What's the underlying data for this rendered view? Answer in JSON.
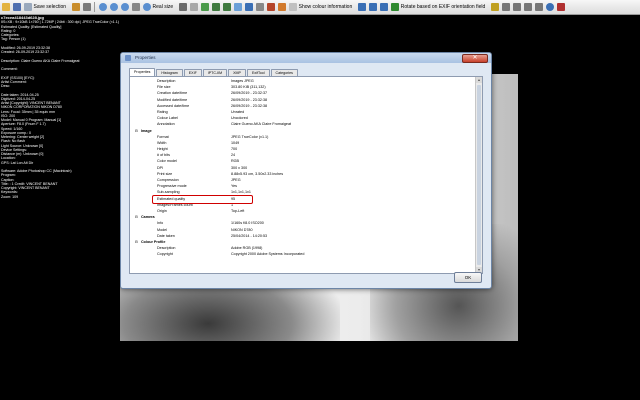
{
  "toolbar": {
    "save_selection": "Save selection",
    "real_size": "Real size",
    "show_colour_information": "Show colour information",
    "rotate_exif": "Rotate based on EXIF orientation field"
  },
  "info_panel": {
    "filename": "c7ecea418443d628.jpg",
    "lines": [
      "IIS=XB : 9×10kB 1×760 | 1.72MP | 24bit : 300 dpi | JPEG TrueColor (×1.1)",
      "Estimated Quality: [Estimated Quality]",
      "Rating: 0",
      "Categories:",
      "Tag: Person (1)",
      "",
      "Modified: 26-09-2019 23:32:38",
      "Created: 26-09-2019 23:32:37",
      "",
      "Description: Claire Gueno AKA Claire Fromaigeat",
      "",
      "Comment:",
      "",
      "EXIF (SS100) [EYC]:",
      "Artist Comment:",
      "Desc:",
      "",
      "Date taken: 2014-04-25",
      "Digitized: 2014-04-25",
      "Artist [Copyright]: VINCENT BENANT",
      "NIKON CORPORATION NIKON D780",
      "Lens: Focal: 35mm | 35 equiv mm",
      "ISO: 200",
      "Model: Manual 0 Program: Manual [1]",
      "Aperture: F8.0 (Fnum F 1.7)",
      "Speed: 1/160",
      "Exposure comp.: 0",
      "Metering: Center weight [2]",
      "Flash: No flash",
      "Light Source: Unknown [0]",
      "Device Settings:",
      "Distance (m): Unknown [0]",
      "Location:",
      "GPS: Lat Lon Alt Dir",
      "",
      "Software: Adobe Photoshop CC (Macintosh)",
      "Program:",
      "Caption:",
      "Title: : 1 Credit: VINCENT BENANT",
      "Copyright: VINCENT BENANT",
      "Keywords:",
      "Zoom: 109"
    ]
  },
  "dialog": {
    "title": "Properties",
    "tabs": [
      "Properties",
      "Histogram",
      "EXIF",
      "IPTC-IIM",
      "XMP",
      "ExifTool",
      "Categories"
    ],
    "rows": [
      {
        "type": "item",
        "key": "Description",
        "value": "Images JPEG"
      },
      {
        "type": "item",
        "key": "File size",
        "value": "303.80 KiB (311,132)"
      },
      {
        "type": "item",
        "key": "Creation date/time",
        "value": "26/09/2019 - 23:32:37"
      },
      {
        "type": "item",
        "key": "Modified date/time",
        "value": "26/09/2019 - 23:32:38"
      },
      {
        "type": "item",
        "key": "Accessed date/time",
        "value": "26/09/2019 - 23:32:38"
      },
      {
        "type": "item",
        "key": "Rating",
        "value": "Unrated"
      },
      {
        "type": "item",
        "key": "Colour Label",
        "value": "Uncolored"
      },
      {
        "type": "item",
        "key": "Annotation",
        "value": "Claire Gueno AKA Claire Fromaigeat"
      },
      {
        "type": "group",
        "key": "Image",
        "toggle": "⊟"
      },
      {
        "type": "item",
        "key": "Format",
        "value": "JPEG TrueColor (v1.1)"
      },
      {
        "type": "item",
        "key": "Width",
        "value": "1049"
      },
      {
        "type": "item",
        "key": "Height",
        "value": "700"
      },
      {
        "type": "item",
        "key": "# of bits",
        "value": "24"
      },
      {
        "type": "item",
        "key": "Color model",
        "value": "RGB"
      },
      {
        "type": "item",
        "key": "DPI",
        "value": "300 x 300"
      },
      {
        "type": "item",
        "key": "Print size",
        "value": "8.88x5.93 cm, 3.50x2.33 inches"
      },
      {
        "type": "item",
        "key": "Compression",
        "value": "JPEG"
      },
      {
        "type": "item",
        "key": "Progressive mode",
        "value": "Yes"
      },
      {
        "type": "item",
        "key": "Sub-sampling",
        "value": "1x1,1x1,1x1"
      },
      {
        "type": "item",
        "key": "Estimated quality",
        "value": "95"
      },
      {
        "type": "item",
        "key": "Images/Frames count",
        "value": "1"
      },
      {
        "type": "item",
        "key": "Origin",
        "value": "Top-Left"
      },
      {
        "type": "group",
        "key": "Camera",
        "toggle": "⊟"
      },
      {
        "type": "item",
        "key": "Info",
        "value": "1/160s f/8.0 ISO200"
      },
      {
        "type": "item",
        "key": "Model",
        "value": "NIKON D780"
      },
      {
        "type": "item",
        "key": "Date taken",
        "value": "25/04/2014 - 14:20:53"
      },
      {
        "type": "group",
        "key": "Colour Profile",
        "toggle": "⊟"
      },
      {
        "type": "item",
        "key": "Description",
        "value": "Adobe RGB (1998)"
      },
      {
        "type": "item",
        "key": "Copyright",
        "value": "Copyright 2000 Adobe Systems Incorporated"
      }
    ],
    "ok_label": "OK",
    "close_glyph": "✕"
  },
  "colors": {
    "highlight_border": "#d00000",
    "dialog_bg": "#dfe8f3"
  }
}
